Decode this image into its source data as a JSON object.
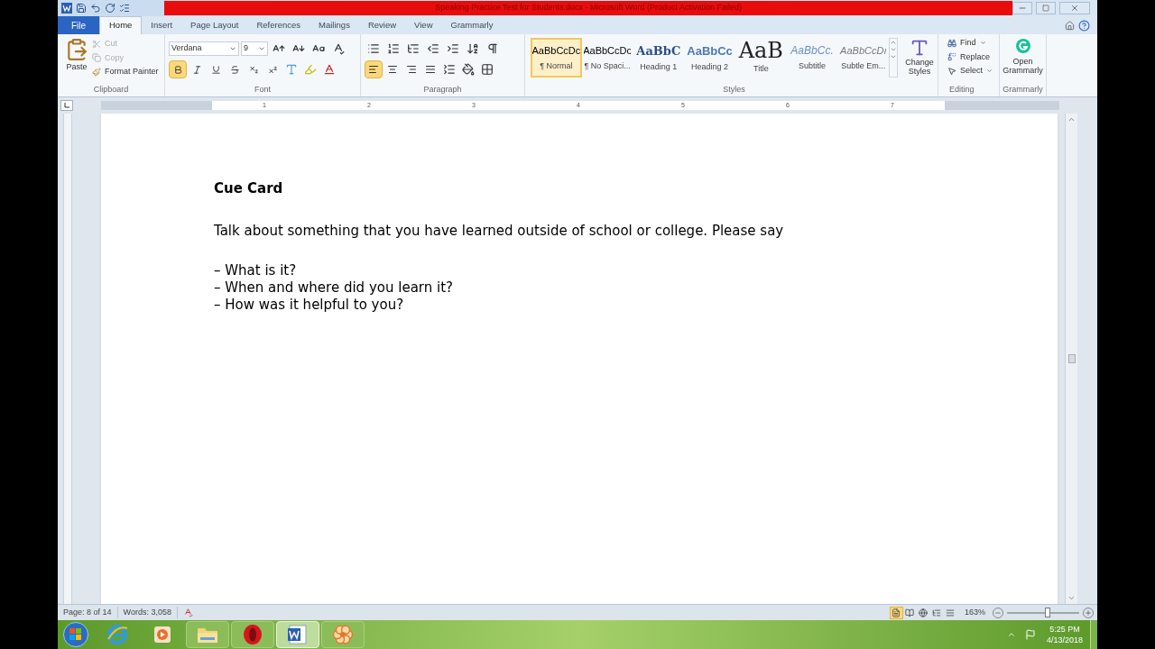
{
  "window": {
    "title": "Speaking Practice Test for Students.docx - Microsoft Word (Product Activation Failed)"
  },
  "tabs": [
    {
      "label": "File",
      "kind": "file",
      "selected": false
    },
    {
      "label": "Home",
      "kind": "tab",
      "selected": true
    },
    {
      "label": "Insert",
      "kind": "tab",
      "selected": false
    },
    {
      "label": "Page Layout",
      "kind": "tab",
      "selected": false
    },
    {
      "label": "References",
      "kind": "tab",
      "selected": false
    },
    {
      "label": "Mailings",
      "kind": "tab",
      "selected": false
    },
    {
      "label": "Review",
      "kind": "tab",
      "selected": false
    },
    {
      "label": "View",
      "kind": "tab",
      "selected": false
    },
    {
      "label": "Grammarly",
      "kind": "tab",
      "selected": false
    }
  ],
  "clipboard": {
    "label": "Clipboard",
    "paste": "Paste",
    "cut": {
      "label": "Cut",
      "disabled": true
    },
    "copy": {
      "label": "Copy",
      "disabled": true
    },
    "format_painter": {
      "label": "Format Painter",
      "disabled": false
    }
  },
  "font": {
    "label": "Font",
    "font_name": "Verdana",
    "font_size": "9",
    "bold": {
      "selected": true
    }
  },
  "paragraph": {
    "label": "Paragraph",
    "alignments": [
      {
        "kind": "left",
        "selected": true
      },
      {
        "kind": "center",
        "selected": false
      },
      {
        "kind": "right",
        "selected": false
      },
      {
        "kind": "justify",
        "selected": false
      }
    ]
  },
  "styles": {
    "label": "Styles",
    "items": [
      {
        "sample": "AaBbCcDc",
        "label": "¶ Normal",
        "kind": "normal",
        "selected": true
      },
      {
        "sample": "AaBbCcDc",
        "label": "¶ No Spaci...",
        "kind": "normal",
        "selected": false
      },
      {
        "sample": "AaBbC",
        "label": "Heading 1",
        "kind": "heading1",
        "selected": false
      },
      {
        "sample": "AaBbCc",
        "label": "Heading 2",
        "kind": "heading2",
        "selected": false
      },
      {
        "sample": "AaB",
        "label": "Title",
        "kind": "title",
        "selected": false
      },
      {
        "sample": "AaBbCc.",
        "label": "Subtitle",
        "kind": "subtitle",
        "selected": false
      },
      {
        "sample": "AaBbCcDı",
        "label": "Subtle Em...",
        "kind": "emphasis",
        "selected": false
      }
    ],
    "change_styles": "Change Styles"
  },
  "editing": {
    "label": "Editing",
    "find": "Find",
    "replace": "Replace",
    "select": "Select"
  },
  "grammarly": {
    "label": "Grammarly",
    "open": "Open Grammarly"
  },
  "ruler": {
    "labels": [
      "1",
      "2",
      "3",
      "4",
      "5",
      "6",
      "7"
    ]
  },
  "document": {
    "heading": "Cue Card",
    "prompt": "Talk about something that you have learned outside of school or college. Please say",
    "bullets": [
      "– What is it?",
      "– When and where did you learn it?",
      "– How was it helpful to you?"
    ]
  },
  "status_bar": {
    "page": "Page: 8 of 14",
    "words": "Words: 3,058",
    "views": [
      {
        "kind": "print",
        "selected": true
      },
      {
        "kind": "reading",
        "selected": false
      },
      {
        "kind": "web",
        "selected": false
      },
      {
        "kind": "outline",
        "selected": false
      },
      {
        "kind": "draft",
        "selected": false
      }
    ],
    "zoom": "163%",
    "zoom_slider": {
      "level": 0.56
    }
  },
  "taskbar": {
    "items": [
      {
        "kind": "ie",
        "selected": false
      },
      {
        "kind": "media",
        "selected": false
      },
      {
        "kind": "explorer",
        "selected": false
      },
      {
        "kind": "opera",
        "selected": false
      },
      {
        "kind": "word",
        "selected": true
      },
      {
        "kind": "app",
        "selected": false
      }
    ],
    "time": "5:25 PM",
    "date": "4/13/2018"
  }
}
